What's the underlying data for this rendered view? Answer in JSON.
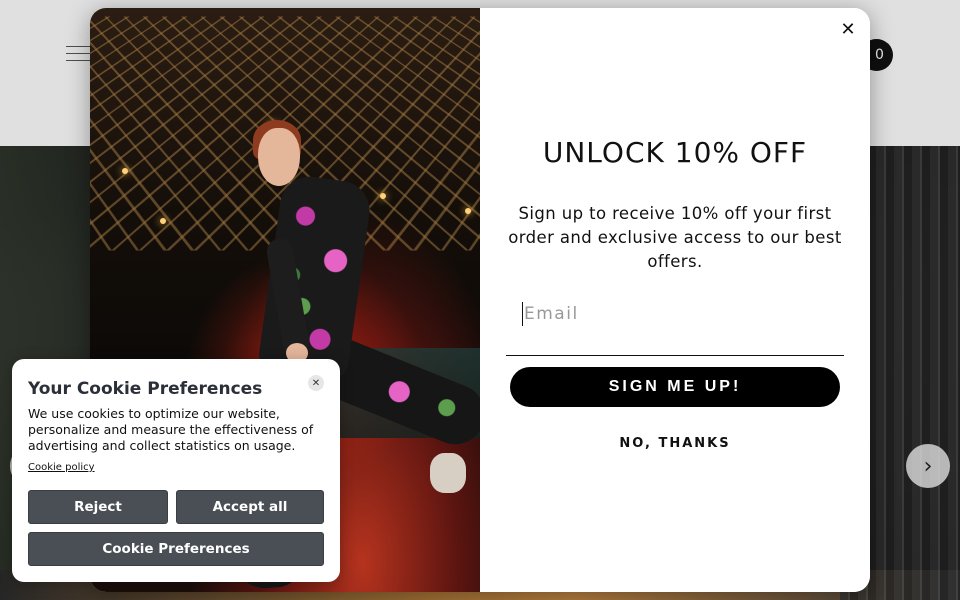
{
  "header": {
    "cart_count": "0"
  },
  "popup": {
    "title": "UNLOCK 10% OFF",
    "description": "Sign up to receive 10% off your first order and exclusive access to our best offers.",
    "email_placeholder": "Email",
    "signup_label": "SIGN ME UP!",
    "decline_label": "NO, THANKS",
    "close_symbol": "✕"
  },
  "cookie": {
    "title": "Your Cookie Preferences",
    "text": "We use cookies to optimize our website, personalize and measure the effectiveness of advertising and collect statistics on usage.",
    "policy_link": "Cookie policy",
    "reject_label": "Reject",
    "accept_label": "Accept all",
    "preferences_label": "Cookie Preferences",
    "close_symbol": "✕"
  },
  "slider": {
    "next_symbol": "›",
    "prev_symbol": "‹"
  },
  "icons": {
    "menu": "hamburger-icon",
    "close": "close-icon",
    "next": "chevron-right-icon",
    "prev": "chevron-left-icon"
  },
  "colors": {
    "button_black": "#000000",
    "cookie_button": "#4a4f55"
  }
}
